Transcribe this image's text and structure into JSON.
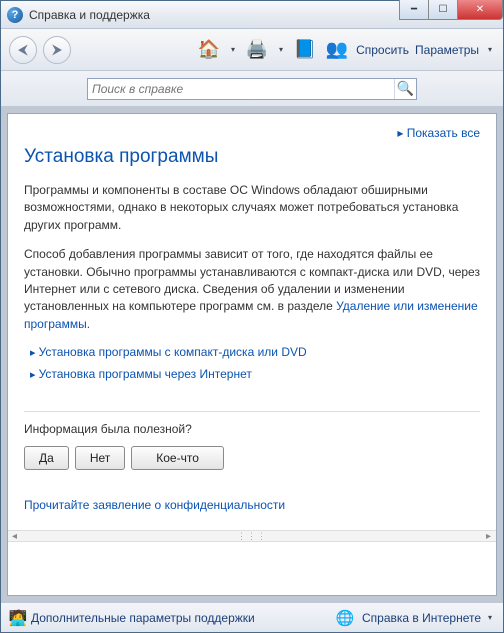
{
  "window": {
    "title": "Справка и поддержка"
  },
  "toolbar": {
    "ask_label": "Спросить",
    "params_label": "Параметры"
  },
  "search": {
    "placeholder": "Поиск в справке"
  },
  "content": {
    "show_all": "Показать все",
    "heading": "Установка программы",
    "para1": "Программы и компоненты в составе ОС Windows обладают обширными возможностями, однако в некоторых случаях может потребоваться установка других программ.",
    "para2a": "Способ добавления программы зависит от того, где находятся файлы ее установки. Обычно программы устанавливаются с компакт-диска или DVD, через Интернет или с сетевого диска. Сведения об удалении и изменении установленных на компьютере программ см. в разделе ",
    "para2_link": "Удаление или изменение программы.",
    "expanders": [
      "Установка программы с компакт-диска или DVD",
      "Установка программы через Интернет"
    ],
    "feedback_q": "Информация была полезной?",
    "feedback_buttons": {
      "yes": "Да",
      "no": "Нет",
      "somewhat": "Кое-что"
    },
    "privacy_link": "Прочитайте заявление о конфиденциальности"
  },
  "footer": {
    "left_label": "Дополнительные параметры поддержки",
    "right_label": "Справка в Интернете"
  }
}
